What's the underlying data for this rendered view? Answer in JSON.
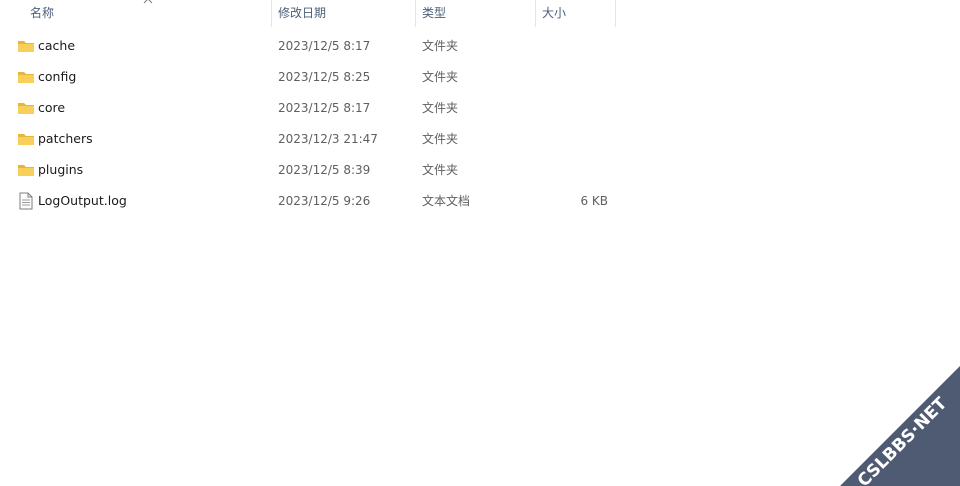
{
  "columns": {
    "name": "名称",
    "date": "修改日期",
    "type": "类型",
    "size": "大小"
  },
  "files": [
    {
      "name": "cache",
      "date": "2023/12/5 8:17",
      "type": "文件夹",
      "size": "",
      "icon": "folder-icon"
    },
    {
      "name": "config",
      "date": "2023/12/5 8:25",
      "type": "文件夹",
      "size": "",
      "icon": "folder-icon"
    },
    {
      "name": "core",
      "date": "2023/12/5 8:17",
      "type": "文件夹",
      "size": "",
      "icon": "folder-icon"
    },
    {
      "name": "patchers",
      "date": "2023/12/3 21:47",
      "type": "文件夹",
      "size": "",
      "icon": "folder-icon"
    },
    {
      "name": "plugins",
      "date": "2023/12/5 8:39",
      "type": "文件夹",
      "size": "",
      "icon": "folder-icon"
    },
    {
      "name": "LogOutput.log",
      "date": "2023/12/5 9:26",
      "type": "文本文档",
      "size": "6 KB",
      "icon": "text-file-icon"
    }
  ],
  "watermark": {
    "text": "CSLBBS·NET",
    "color": "#3f4d66"
  }
}
